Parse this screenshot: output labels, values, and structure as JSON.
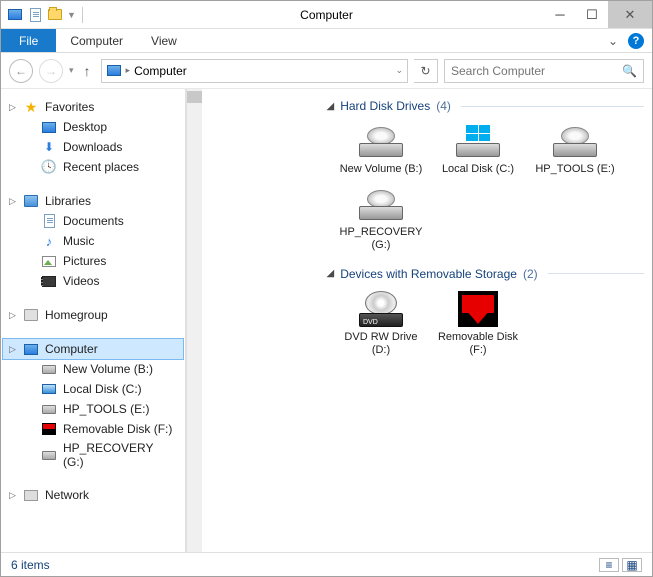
{
  "window": {
    "title": "Computer"
  },
  "ribbon": {
    "file": "File",
    "tabs": [
      "Computer",
      "View"
    ]
  },
  "nav": {
    "breadcrumb": [
      "Computer"
    ],
    "search_placeholder": "Search Computer"
  },
  "sidebar": {
    "favorites": {
      "label": "Favorites",
      "items": [
        "Desktop",
        "Downloads",
        "Recent places"
      ]
    },
    "libraries": {
      "label": "Libraries",
      "items": [
        "Documents",
        "Music",
        "Pictures",
        "Videos"
      ]
    },
    "homegroup": {
      "label": "Homegroup"
    },
    "computer": {
      "label": "Computer",
      "items": [
        "New Volume (B:)",
        "Local Disk (C:)",
        "HP_TOOLS (E:)",
        "Removable Disk (F:)",
        "HP_RECOVERY (G:)"
      ]
    },
    "network": {
      "label": "Network"
    }
  },
  "main": {
    "groups": [
      {
        "title": "Hard Disk Drives",
        "count": 4,
        "items": [
          {
            "label": "New Volume (B:)",
            "icon": "hdd"
          },
          {
            "label": "Local Disk (C:)",
            "icon": "hdd-win"
          },
          {
            "label": "HP_TOOLS (E:)",
            "icon": "hdd"
          },
          {
            "label": "HP_RECOVERY (G:)",
            "icon": "hdd"
          }
        ]
      },
      {
        "title": "Devices with Removable Storage",
        "count": 2,
        "items": [
          {
            "label": "DVD RW Drive (D:)",
            "icon": "dvd"
          },
          {
            "label": "Removable Disk (F:)",
            "icon": "removable"
          }
        ]
      }
    ]
  },
  "status": {
    "items_text": "6 items"
  }
}
